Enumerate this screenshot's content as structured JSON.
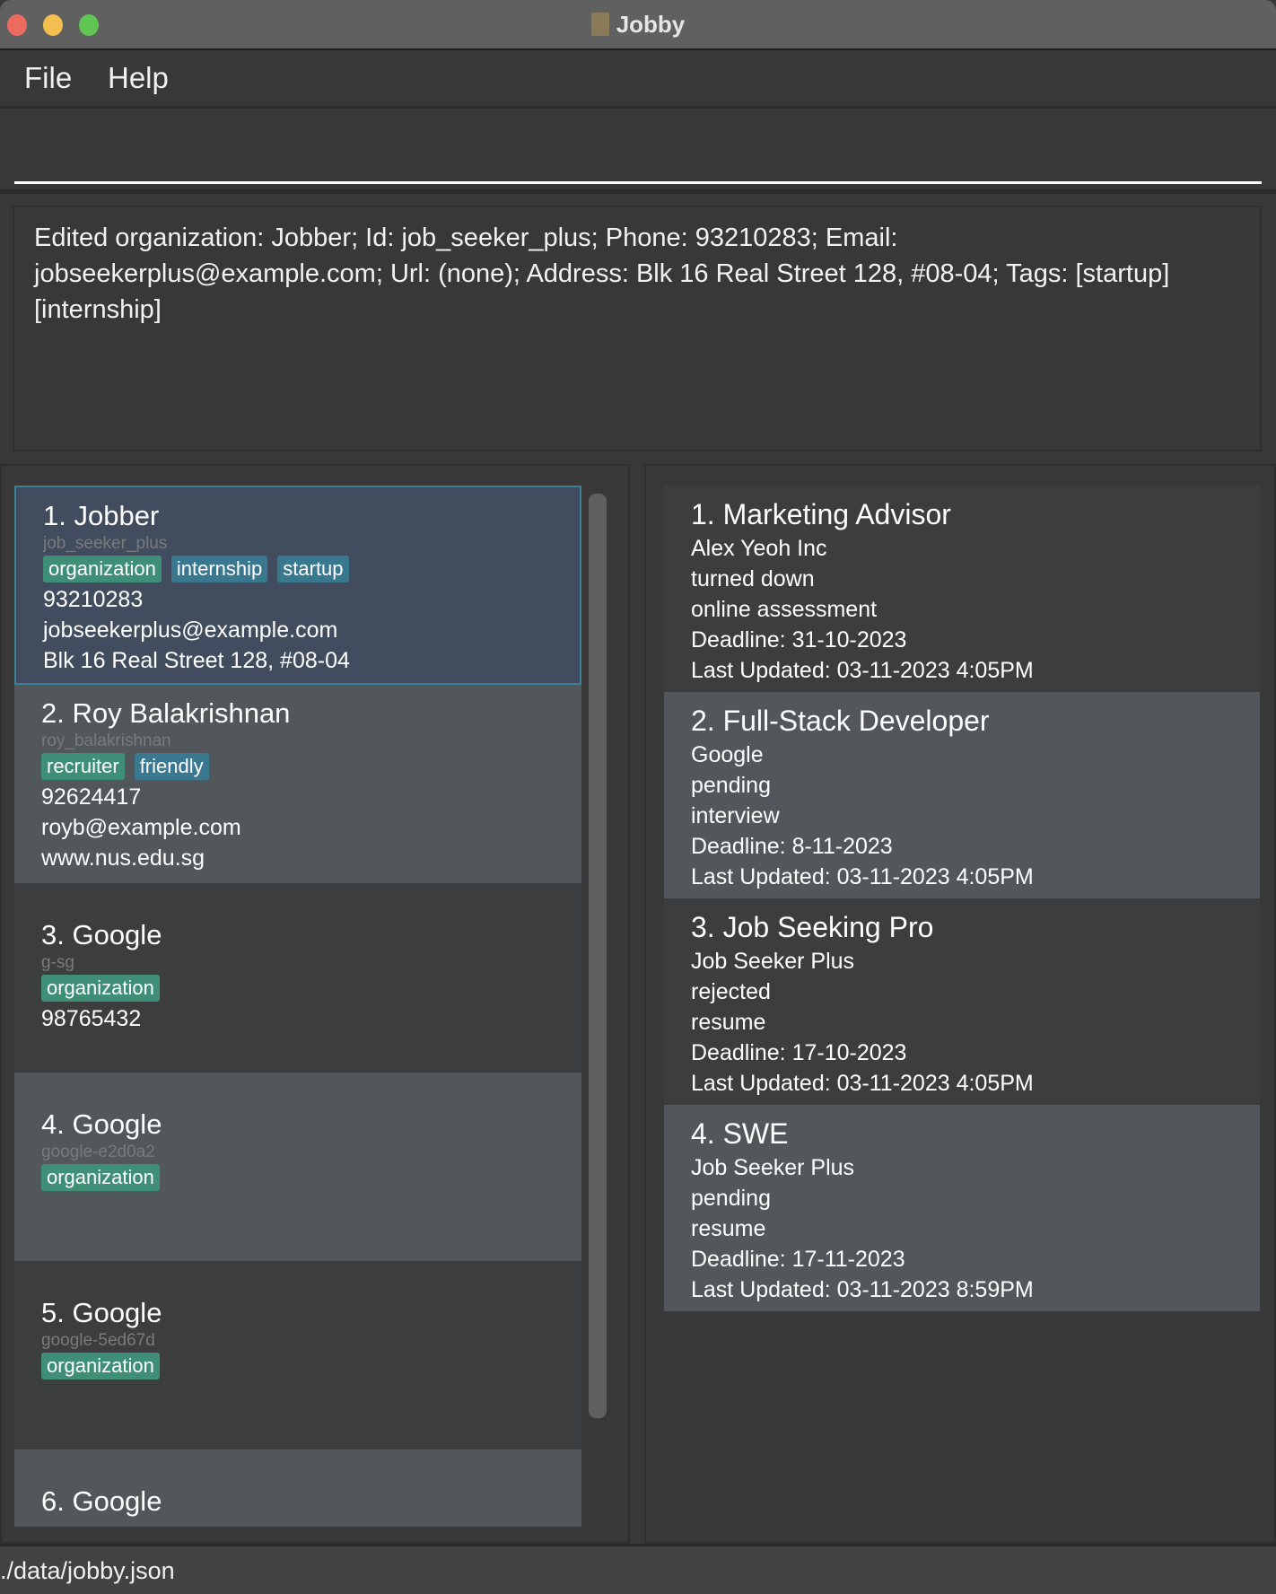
{
  "window": {
    "title": "Jobby"
  },
  "menu": [
    "File",
    "Help"
  ],
  "command": {
    "value": ""
  },
  "result": "Edited organization: Jobber; Id: job_seeker_plus; Phone: 93210283; Email: jobseekerplus@example.com; Url: (none); Address: Blk 16 Real Street 128, #08-04; Tags: [startup][internship]",
  "colors": {
    "tag_green": "#3e8e78",
    "tag_blue": "#3a7890",
    "selected": "#414d5f",
    "selected_border": "#3c8096",
    "alt_row": "#51575a",
    "row": "#3c3d3e"
  },
  "contacts": [
    {
      "title": "1.  Jobber",
      "id": "job_seeker_plus",
      "tags": [
        {
          "label": "organization",
          "kind": "green"
        },
        {
          "label": "internship",
          "kind": "blue"
        },
        {
          "label": "startup",
          "kind": "blue"
        }
      ],
      "lines": [
        "93210283",
        "jobseekerplus@example.com",
        "Blk 16 Real Street 128, #08-04"
      ],
      "selected": true
    },
    {
      "title": "2.  Roy Balakrishnan",
      "id": "roy_balakrishnan",
      "tags": [
        {
          "label": "recruiter",
          "kind": "green"
        },
        {
          "label": "friendly",
          "kind": "blue"
        }
      ],
      "lines": [
        "92624417",
        "royb@example.com",
        "www.nus.edu.sg"
      ]
    },
    {
      "title": "3.  Google",
      "id": "g-sg",
      "tags": [
        {
          "label": "organization",
          "kind": "green"
        }
      ],
      "lines": [
        "98765432"
      ]
    },
    {
      "title": "4.  Google",
      "id": "google-e2d0a2",
      "tags": [
        {
          "label": "organization",
          "kind": "green"
        }
      ],
      "lines": []
    },
    {
      "title": "5.  Google",
      "id": "google-5ed67d",
      "tags": [
        {
          "label": "organization",
          "kind": "green"
        }
      ],
      "lines": []
    },
    {
      "title": "6.  Google",
      "id": "",
      "tags": [],
      "lines": []
    }
  ],
  "jobs": [
    {
      "title": "1.  Marketing Advisor",
      "lines": [
        "Alex Yeoh Inc",
        "turned down",
        "online assessment",
        "Deadline: 31-10-2023",
        "Last Updated: 03-11-2023 4:05PM"
      ]
    },
    {
      "title": "2.  Full-Stack Developer",
      "lines": [
        "Google",
        "pending",
        "interview",
        "Deadline: 8-11-2023",
        "Last Updated: 03-11-2023 4:05PM"
      ]
    },
    {
      "title": "3.  Job Seeking Pro",
      "lines": [
        "Job Seeker Plus",
        "rejected",
        "resume",
        "Deadline: 17-10-2023",
        "Last Updated: 03-11-2023 4:05PM"
      ]
    },
    {
      "title": "4.  SWE",
      "lines": [
        "Job Seeker Plus",
        "pending",
        "resume",
        "Deadline: 17-11-2023",
        "Last Updated: 03-11-2023 8:59PM"
      ]
    }
  ],
  "status": "./data/jobby.json"
}
